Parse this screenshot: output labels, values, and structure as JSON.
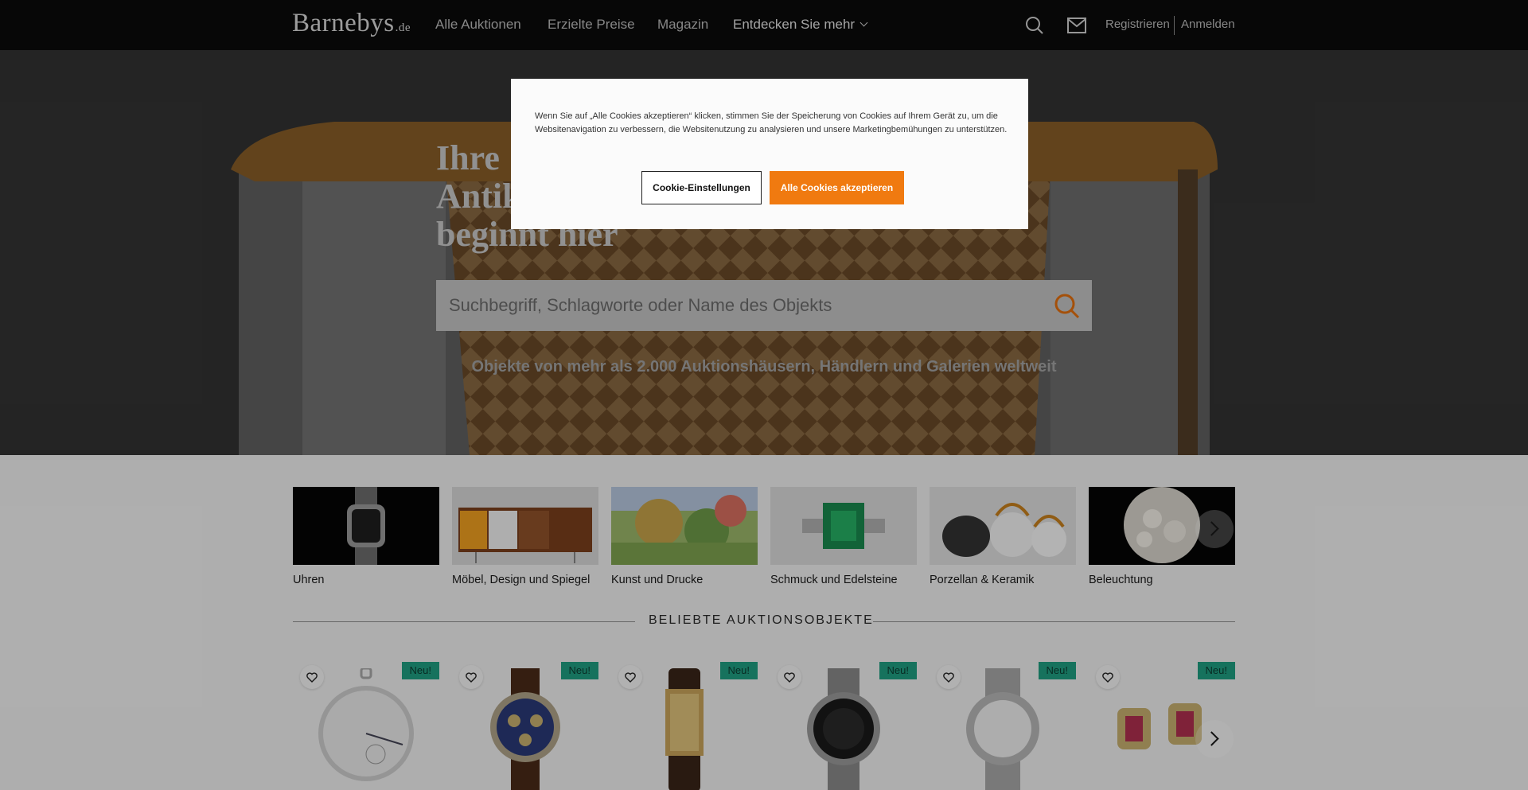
{
  "nav": {
    "logo": "Barnebys",
    "logo_tld": ".de",
    "links": [
      "Alle Auktionen",
      "Erzielte Preise",
      "Magazin",
      "Entdecken Sie mehr"
    ],
    "register": "Registrieren",
    "login": "Anmelden"
  },
  "hero": {
    "title_lines": [
      "Ihre",
      "Antik",
      "beginnt hier"
    ],
    "search_placeholder": "Suchbegriff, Schlagworte oder Name des Objekts",
    "subtitle": "Objekte von mehr als 2.000 Auktionshäusern, Händlern und Galerien weltweit"
  },
  "categories": [
    {
      "label": "Uhren"
    },
    {
      "label": "Möbel, Design und Spiegel"
    },
    {
      "label": "Kunst und Drucke"
    },
    {
      "label": "Schmuck und Edelsteine"
    },
    {
      "label": "Porzellan & Keramik"
    },
    {
      "label": "Beleuchtung"
    }
  ],
  "popular": {
    "title": "BELIEBTE AUKTIONSOBJEKTE",
    "badge": "Neu!",
    "items": [
      {
        "kind": "pocket-watch"
      },
      {
        "kind": "chronograph"
      },
      {
        "kind": "gold-watch"
      },
      {
        "kind": "diver-watch"
      },
      {
        "kind": "steel-watch"
      },
      {
        "kind": "earrings"
      }
    ]
  },
  "cookie": {
    "text": "Wenn Sie auf „Alle Cookies akzeptieren“ klicken, stimmen Sie der Speicherung von Cookies auf Ihrem Gerät zu, um die Websitenavigation zu verbessern, die Websitenutzung zu analysieren und unsere Marketingbemühungen zu unterstützen.",
    "settings_label": "Cookie-Einstellungen",
    "accept_label": "Alle Cookies akzeptieren"
  },
  "colors": {
    "accent": "#f07a10",
    "badge": "#1f9e82",
    "nav": "#0b0b0b"
  }
}
